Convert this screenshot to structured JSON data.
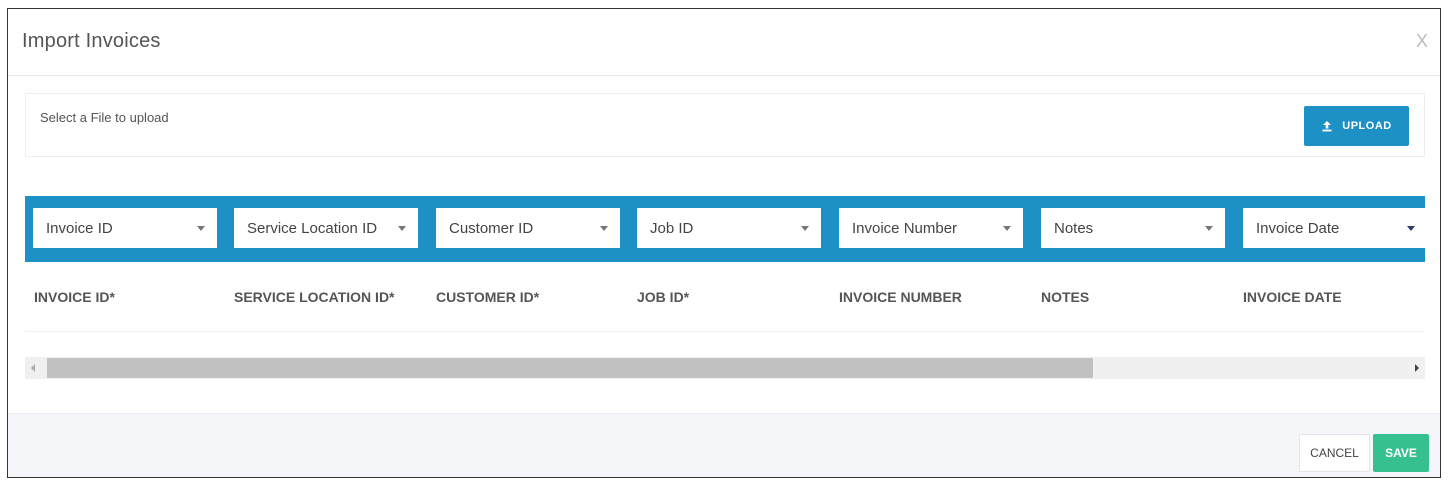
{
  "dialog": {
    "title": "Import Invoices",
    "close_label": "X"
  },
  "upload": {
    "label": "Select a File to upload",
    "button_label": "UPLOAD",
    "button_icon": "upload-icon"
  },
  "mapping": {
    "selects": [
      {
        "value": "Invoice ID"
      },
      {
        "value": "Service Location ID"
      },
      {
        "value": "Customer ID"
      },
      {
        "value": "Job ID"
      },
      {
        "value": "Invoice Number"
      },
      {
        "value": "Notes"
      },
      {
        "value": "Invoice Date"
      }
    ]
  },
  "columns": {
    "headers": [
      "INVOICE ID*",
      "SERVICE LOCATION ID*",
      "CUSTOMER ID*",
      "JOB ID*",
      "INVOICE NUMBER",
      "NOTES",
      "INVOICE DATE"
    ]
  },
  "footer": {
    "cancel_label": "CANCEL",
    "save_label": "SAVE"
  },
  "colors": {
    "accent": "#1d91c6",
    "save": "#36c08f"
  }
}
